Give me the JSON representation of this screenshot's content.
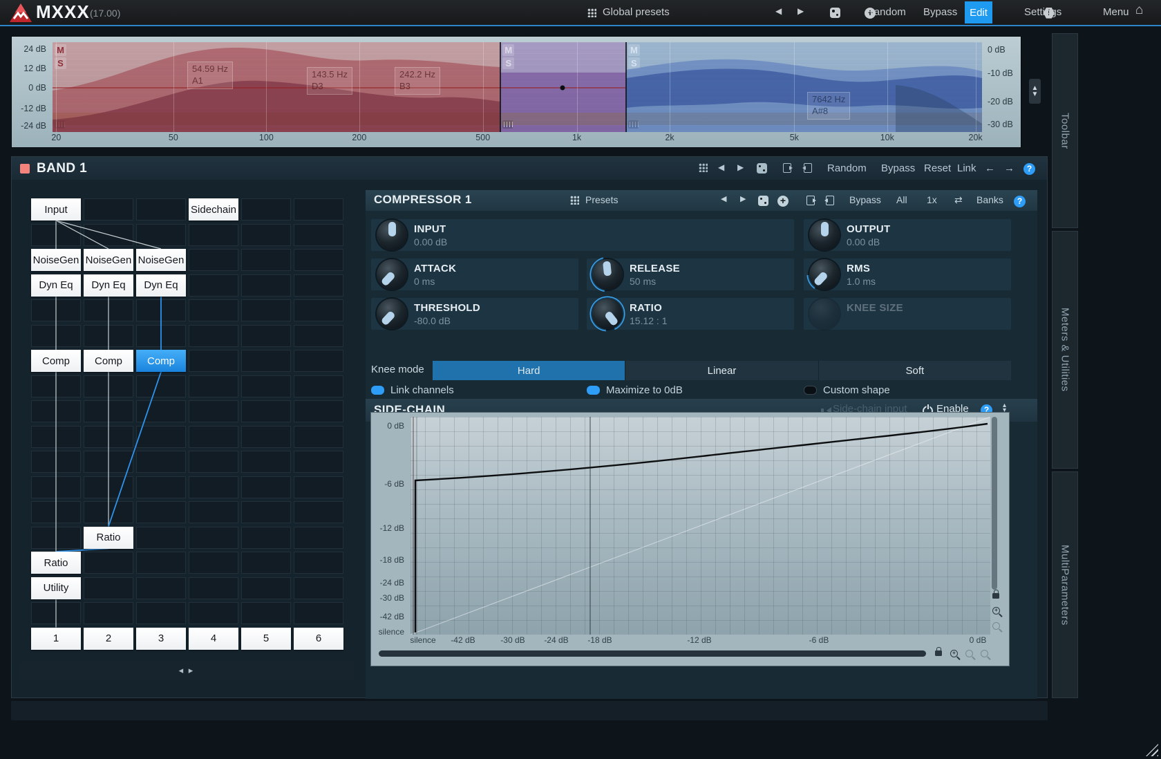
{
  "topbar": {
    "logo": "MXXX",
    "version": "(17.00)",
    "global_presets": "Global presets",
    "random": "Random",
    "bypass": "Bypass",
    "edit": "Edit",
    "settings": "Settings",
    "menu": "Menu"
  },
  "eq": {
    "left_scale": [
      "24 dB",
      "12 dB",
      "0 dB",
      "-12 dB",
      "-24 dB"
    ],
    "right_scale": [
      "0 dB",
      "-10 dB",
      "-20 dB",
      "-30 dB"
    ],
    "freq_labels": [
      "20",
      "50",
      "100",
      "200",
      "500",
      "1k",
      "2k",
      "5k",
      "10k",
      "20k"
    ],
    "ms_badges": [
      "M",
      "S"
    ],
    "point_labels": [
      {
        "freq": "54.59 Hz",
        "note": "A1"
      },
      {
        "freq": "143.5 Hz",
        "note": "D3"
      },
      {
        "freq": "242.2 Hz",
        "note": "B3"
      },
      {
        "freq": "7642 Hz",
        "note": "A#8"
      }
    ]
  },
  "side_tabs": [
    "Toolbar",
    "Meters & Utilities",
    "MultiParameters"
  ],
  "band": {
    "title": "BAND 1",
    "toolbar": [
      "Random",
      "Bypass",
      "Reset",
      "Link"
    ]
  },
  "matrix": {
    "slots": [
      "1",
      "2",
      "3",
      "4",
      "5",
      "6"
    ],
    "modules": [
      {
        "label": "Input",
        "col": 1,
        "row": 1
      },
      {
        "label": "Sidechain",
        "col": 4,
        "row": 1
      },
      {
        "label": "NoiseGen",
        "col": 1,
        "row": 3
      },
      {
        "label": "NoiseGen",
        "col": 2,
        "row": 3
      },
      {
        "label": "NoiseGen",
        "col": 3,
        "row": 3
      },
      {
        "label": "Dyn Eq",
        "col": 1,
        "row": 4
      },
      {
        "label": "Dyn Eq",
        "col": 2,
        "row": 4
      },
      {
        "label": "Dyn Eq",
        "col": 3,
        "row": 4
      },
      {
        "label": "Comp",
        "col": 1,
        "row": 7
      },
      {
        "label": "Comp",
        "col": 2,
        "row": 7
      },
      {
        "label": "Comp",
        "col": 3,
        "row": 7,
        "selected": true
      },
      {
        "label": "Ratio",
        "col": 2,
        "row": 14
      },
      {
        "label": "Ratio",
        "col": 1,
        "row": 15
      },
      {
        "label": "Utility",
        "col": 1,
        "row": 16
      }
    ],
    "connections": [
      {
        "from": [
          1,
          1
        ],
        "to": [
          1,
          3
        ],
        "color": "white"
      },
      {
        "from": [
          1,
          1
        ],
        "to": [
          2,
          3
        ],
        "color": "white"
      },
      {
        "from": [
          1,
          1
        ],
        "to": [
          3,
          3
        ],
        "color": "white"
      },
      {
        "from": [
          1,
          4
        ],
        "to": [
          1,
          7
        ],
        "color": "white"
      },
      {
        "from": [
          2,
          4
        ],
        "to": [
          2,
          7
        ],
        "color": "white"
      },
      {
        "from": [
          3,
          4
        ],
        "to": [
          3,
          7
        ],
        "color": "blue"
      },
      {
        "from": [
          1,
          7
        ],
        "to": [
          1,
          15
        ],
        "color": "white"
      },
      {
        "from": [
          2,
          7
        ],
        "to": [
          2,
          14
        ],
        "color": "white"
      },
      {
        "from": [
          3,
          7
        ],
        "to": [
          2,
          14
        ],
        "color": "blue"
      },
      {
        "from": [
          2,
          14
        ],
        "to": [
          1,
          15
        ],
        "color": "blue"
      },
      {
        "from": [
          1,
          16
        ],
        "to": [
          1,
          18
        ],
        "color": "white"
      }
    ]
  },
  "compressor": {
    "title": "COMPRESSOR 1",
    "presets": "Presets",
    "header_buttons": [
      "Bypass",
      "All",
      "1x",
      "Banks"
    ],
    "knobs": [
      {
        "id": "input",
        "label": "INPUT",
        "value": "0.00 dB"
      },
      {
        "id": "output",
        "label": "OUTPUT",
        "value": "0.00 dB"
      },
      {
        "id": "attack",
        "label": "ATTACK",
        "value": "0 ms"
      },
      {
        "id": "release",
        "label": "RELEASE",
        "value": "50 ms"
      },
      {
        "id": "rms",
        "label": "RMS",
        "value": "1.0 ms"
      },
      {
        "id": "threshold",
        "label": "THRESHOLD",
        "value": "-80.0 dB"
      },
      {
        "id": "ratio",
        "label": "RATIO",
        "value": "15.12 : 1"
      },
      {
        "id": "knee",
        "label": "KNEE SIZE",
        "value": ""
      }
    ],
    "knee_mode": {
      "label": "Knee mode",
      "options": [
        "Hard",
        "Linear",
        "Soft"
      ],
      "selected": "Hard"
    },
    "toggles": [
      {
        "label": "Link channels",
        "on": true
      },
      {
        "label": "Maximize to 0dB",
        "on": true
      },
      {
        "label": "Custom shape",
        "on": false
      }
    ]
  },
  "sidechain": {
    "title": "SIDE-CHAIN",
    "input_label": "Side-chain input",
    "enable": "Enable",
    "graph": {
      "y_labels": [
        "0 dB",
        "-6 dB",
        "-12 dB",
        "-18 dB",
        "-24 dB",
        "-30 dB",
        "-42 dB",
        "silence"
      ],
      "x_labels": [
        "silence",
        "-42 dB",
        "-30 dB",
        "-24 dB",
        "-18 dB",
        "-12 dB",
        "-6 dB",
        "0 dB"
      ]
    }
  }
}
